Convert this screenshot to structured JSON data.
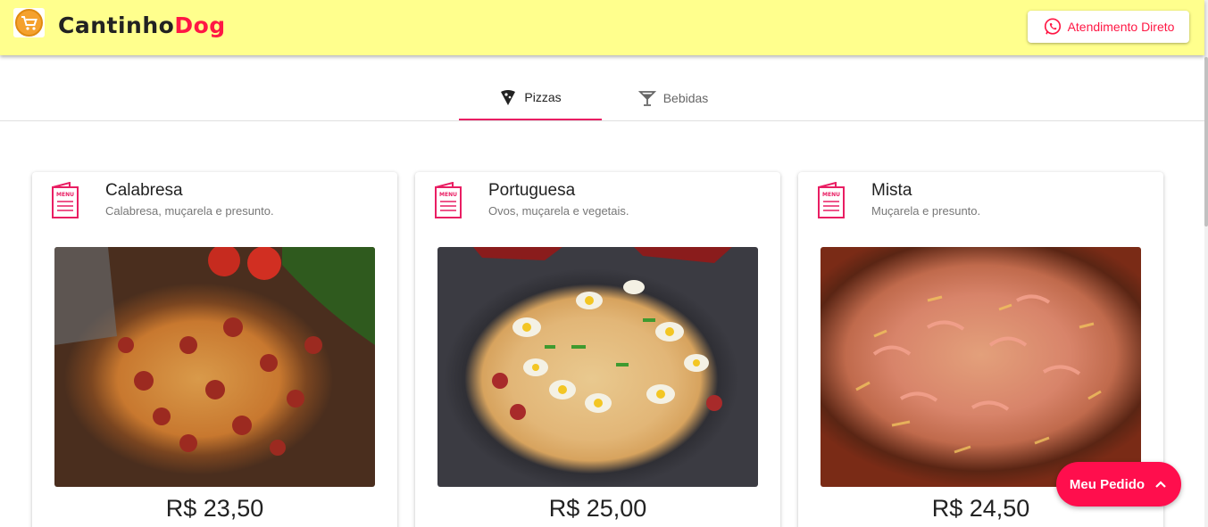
{
  "header": {
    "brand_part1": "Cantinho",
    "brand_part2": "Dog",
    "attend_label": "Atendimento Direto",
    "logo_icon": "shopping-cart-icon",
    "attend_icon": "whatsapp-icon"
  },
  "tabs": [
    {
      "label": "Pizzas",
      "icon": "pizza-slice-icon",
      "active": true
    },
    {
      "label": "Bebidas",
      "icon": "cocktail-glass-icon",
      "active": false
    }
  ],
  "products": [
    {
      "name": "Calabresa",
      "description": "Calabresa, muçarela e presunto.",
      "price": "R$ 23,50"
    },
    {
      "name": "Portuguesa",
      "description": "Ovos, muçarela e vegetais.",
      "price": "R$ 25,00"
    },
    {
      "name": "Mista",
      "description": "Muçarela e presunto.",
      "price": "R$ 24,50"
    }
  ],
  "order_button": {
    "label": "Meu Pedido",
    "icon": "chevron-up-icon"
  },
  "colors": {
    "header_bg": "#ffff8d",
    "accent": "#ff1744",
    "tab_indicator": "#e91e63",
    "fab": "#ff0e4d"
  }
}
